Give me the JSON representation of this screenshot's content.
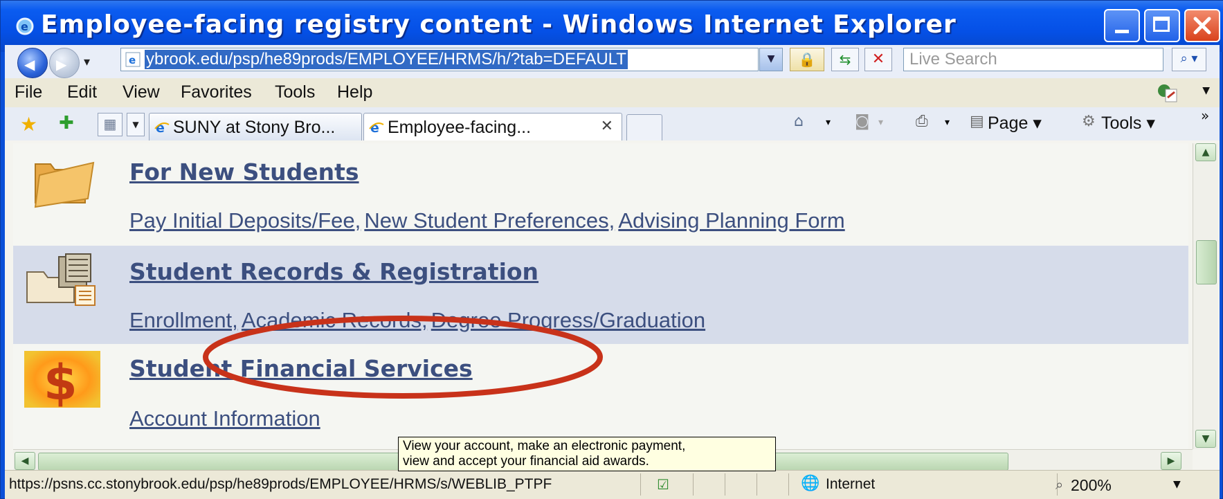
{
  "window": {
    "title": "Employee-facing registry content - Windows Internet Explorer"
  },
  "address_bar": {
    "url": "ybrook.edu/psp/he89prods/EMPLOYEE/HRMS/h/?tab=DEFAULT",
    "search_placeholder": "Live Search"
  },
  "menu": {
    "file": "File",
    "edit": "Edit",
    "view": "View",
    "favorites": "Favorites",
    "tools": "Tools",
    "help": "Help"
  },
  "tabs": [
    {
      "label": "SUNY at Stony Bro..."
    },
    {
      "label": "Employee-facing..."
    }
  ],
  "command_bar": {
    "page": "Page",
    "tools": "Tools"
  },
  "sections": [
    {
      "heading": "For New Students",
      "links": [
        "Pay Initial Deposits/Fee,",
        "New Student Preferences,",
        "Advising Planning Form"
      ]
    },
    {
      "heading": "Student Records & Registration",
      "links": [
        "Enrollment,",
        "Academic Records,",
        "Degree Progress/Graduation"
      ]
    },
    {
      "heading": "Student Financial Services",
      "links": [
        "Account Information"
      ]
    }
  ],
  "tooltip": {
    "line1": "View your account, make an electronic payment,",
    "line2": "view and accept your financial aid awards."
  },
  "status_bar": {
    "url": "https://psns.cc.stonybrook.edu/psp/he89prods/EMPLOYEE/HRMS/s/WEBLIB_PTPF",
    "zone": "Internet",
    "zoom": "200%"
  },
  "colors": {
    "link": "#3c4f7f",
    "highlight_row": "#d6dcea",
    "annotation_ellipse": "#c8321a"
  }
}
